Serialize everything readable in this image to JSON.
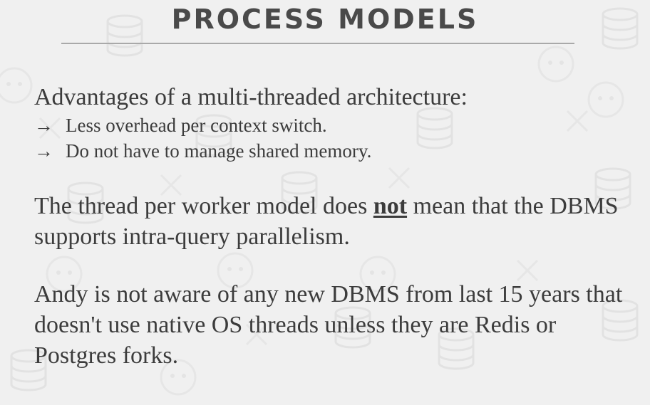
{
  "slide": {
    "title": "PROCESS MODELS",
    "section1": {
      "heading": "Advantages of a multi-threaded architecture:",
      "bullets": [
        {
          "arrow": "→",
          "text": "Less overhead per context switch."
        },
        {
          "arrow": "→",
          "text": "Do not have to manage shared memory."
        }
      ]
    },
    "para1": {
      "before": "The thread per worker model does ",
      "emphasis": "not",
      "after": " mean that the DBMS supports intra-query parallelism."
    },
    "para2": "Andy is not aware of any new DBMS from last 15 years that doesn't use native OS threads unless they are Redis or Postgres forks."
  },
  "colors": {
    "background": "#f0f0f0",
    "title": "#4a4a4a",
    "text": "#3c3c3c",
    "rule": "#a9a9a9"
  }
}
